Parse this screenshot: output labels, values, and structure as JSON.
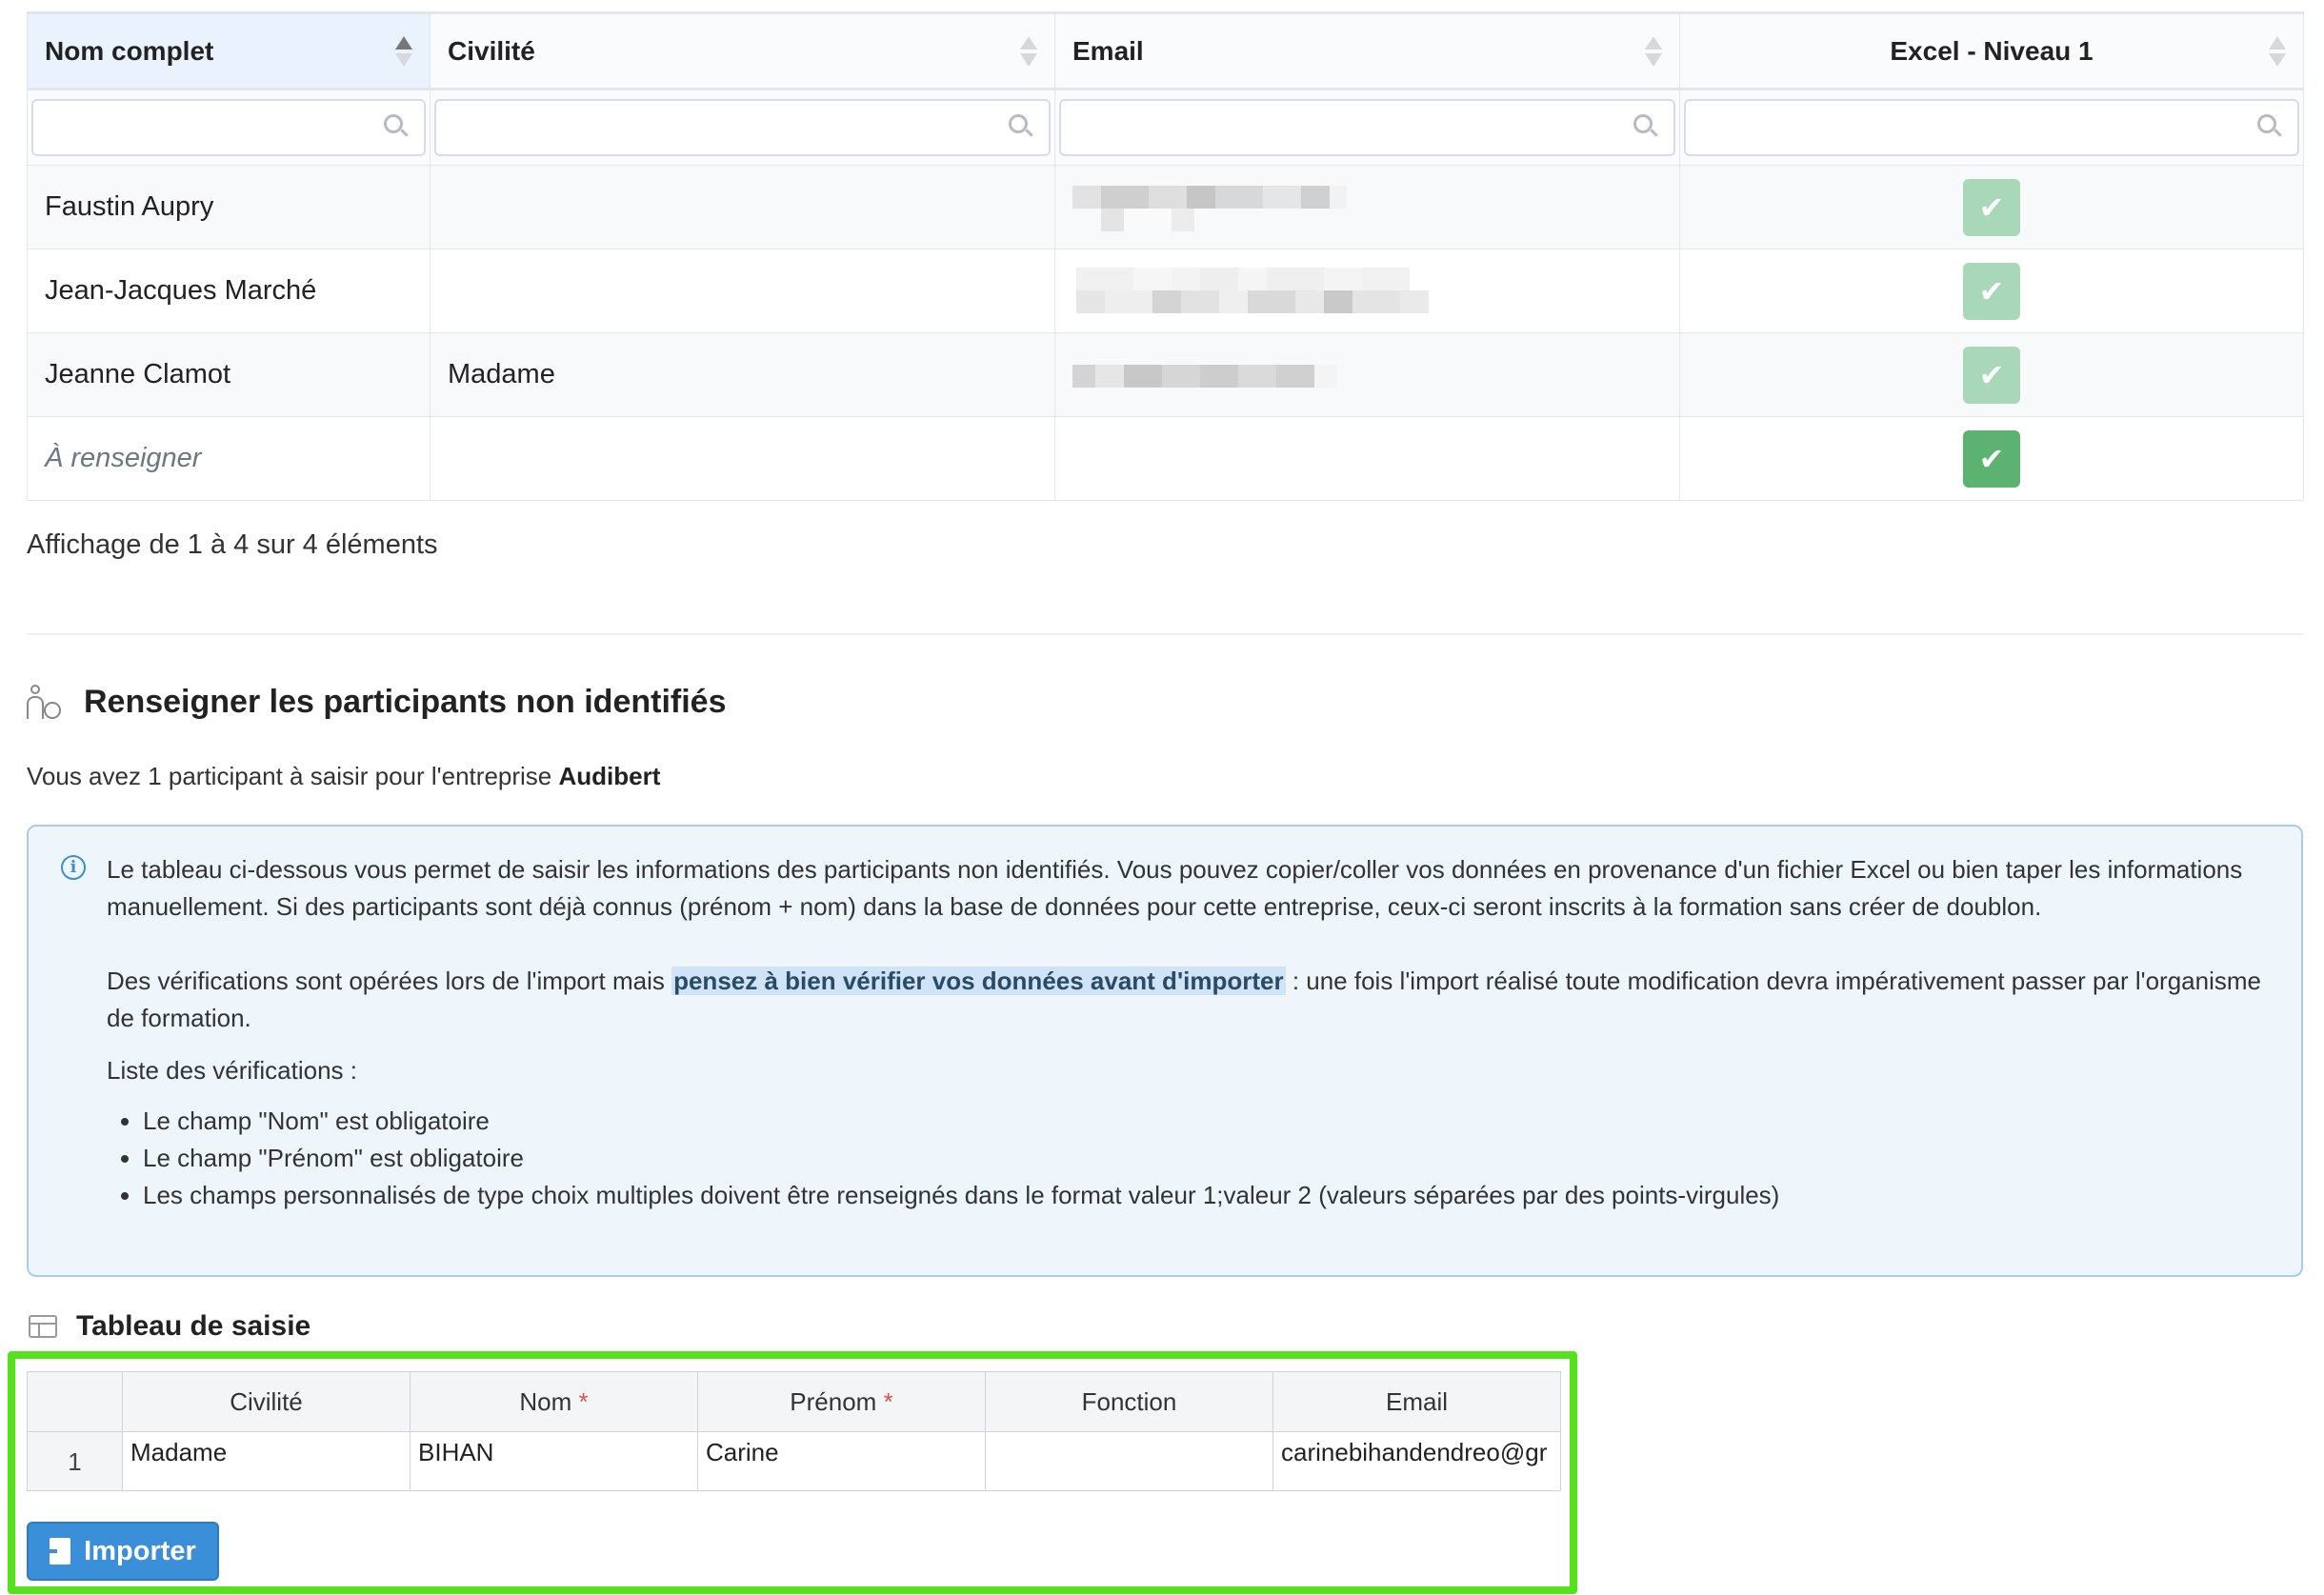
{
  "participants_table": {
    "columns": [
      {
        "label": "Nom complet",
        "sort": "asc"
      },
      {
        "label": "Civilité",
        "sort": "none"
      },
      {
        "label": "Email",
        "sort": "none"
      },
      {
        "label": "Excel - Niveau 1",
        "sort": "none"
      }
    ],
    "rows": [
      {
        "name": "Faustin Aupry",
        "civility": "",
        "email_blurred": true,
        "excel_level_1": true
      },
      {
        "name": "Jean-Jacques Marché",
        "civility": "",
        "email_blurred": true,
        "excel_level_1": true
      },
      {
        "name": "Jeanne Clamot",
        "civility": "Madame",
        "email_blurred": true,
        "excel_level_1": true
      },
      {
        "name": "À renseigner",
        "civility": "",
        "email_blurred": false,
        "excel_level_1": true
      }
    ],
    "summary": "Affichage de 1 à 4 sur 4 éléments"
  },
  "section": {
    "title": "Renseigner les participants non identifiés",
    "intro_prefix": "Vous avez 1 participant à saisir pour l'entreprise ",
    "company": "Audibert"
  },
  "info": {
    "paragraph1": "Le tableau ci-dessous vous permet de saisir les informations des participants non identifiés. Vous pouvez copier/coller vos données en provenance d'un fichier Excel ou bien taper les informations manuellement. Si des participants sont déjà connus (prénom + nom) dans la base de données pour cette entreprise, ceux-ci seront inscrits à la formation sans créer de doublon.",
    "paragraph2_before": "Des vérifications sont opérées lors de l'import mais ",
    "paragraph2_highlight": "pensez à bien vérifier vos données avant d'importer",
    "paragraph2_after": " : une fois l'import réalisé toute modification devra impérativement passer par l'organisme de formation.",
    "list_title": "Liste des vérifications :",
    "checks": [
      "Le champ \"Nom\" est obligatoire",
      "Le champ \"Prénom\" est obligatoire",
      "Les champs personnalisés de type choix multiples doivent être renseignés dans le format valeur 1;valeur 2 (valeurs séparées par des points-virgules)"
    ]
  },
  "entry_table": {
    "title": "Tableau de saisie",
    "headers": {
      "civility": "Civilité",
      "last_name": "Nom",
      "first_name": "Prénom",
      "function": "Fonction",
      "email": "Email",
      "required_mark": "*"
    },
    "rows": [
      {
        "num": "1",
        "civility": "Madame",
        "last_name": "BIHAN",
        "first_name": "Carine",
        "function": "",
        "email": "carinebihandendreo@gr"
      }
    ]
  },
  "import_button": {
    "label": "Importer"
  },
  "colors": {
    "accent": "#3b8fd8",
    "check_light": "#a9d8b8",
    "check_strong": "#5cb270",
    "focus_frame": "#56e01e",
    "info_bg": "#eef6fc"
  }
}
